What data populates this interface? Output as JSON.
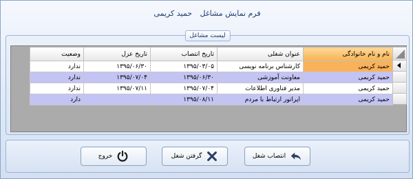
{
  "window": {
    "title_prefix": "فرم نمایش مشاغل",
    "person_name": "حمید کریمی"
  },
  "group": {
    "legend": "لیست مشاغل"
  },
  "grid": {
    "columns": [
      "نام و نام خانوادگی",
      "عنوان شغلی",
      "تاریخ انتصاب",
      "تاریخ عزل",
      "وضعیت"
    ],
    "rows": [
      [
        "حمید کریمی",
        "کارشناس برنامه نویسی",
        "۱۳۹۵/۰۳/۰۵",
        "۱۳۹۵/۰۶/۳۰",
        "ندارد"
      ],
      [
        "حمید کریمی",
        "معاونت آموزشی",
        "۱۳۹۵/۰۶/۳۰",
        "۱۳۹۵/۰۷/۰۴",
        "ندارد"
      ],
      [
        "حمید کریمی",
        "مدیر فناوری اطلاعات",
        "۱۳۹۵/۰۷/۰۴",
        "۱۳۹۵/۰۷/۱۱",
        "ندارد"
      ],
      [
        "حمید کریمی",
        "اپراتور ارتباط با مردم",
        "۱۳۹۵/۰۸/۱۱",
        "",
        "دارد"
      ]
    ],
    "selected_row": 0
  },
  "buttons": {
    "assign_label": "انتصاب شغل",
    "revoke_label": "گرفتن شغل",
    "exit_label": "خروج"
  },
  "colors": {
    "accent": "#1e3c6e",
    "selected_header": "#f5b352",
    "alt_row": "#c3c3f4"
  }
}
